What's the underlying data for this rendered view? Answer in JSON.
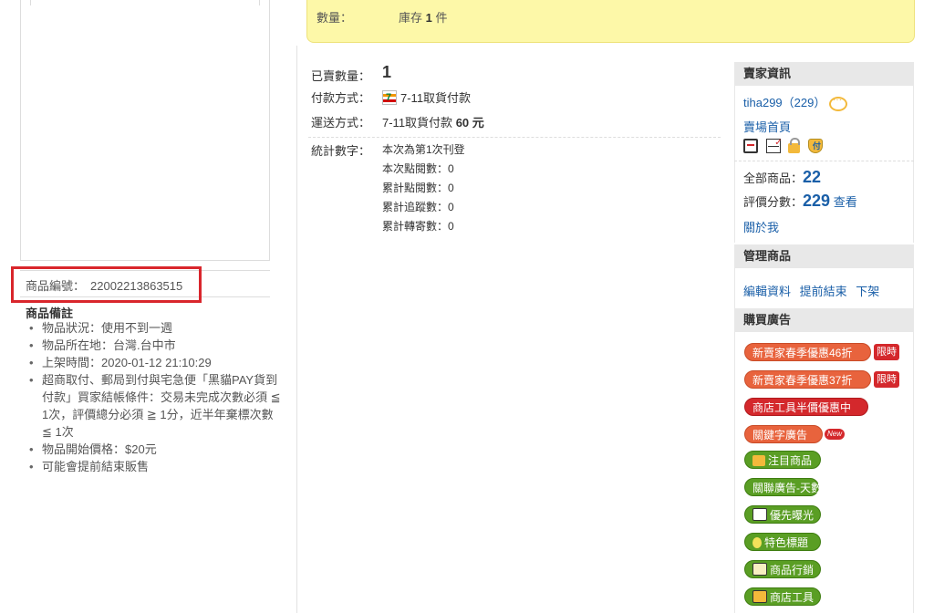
{
  "left": {
    "product_id_label": "商品編號：",
    "product_id_value": "22002213863515",
    "notes_title": "商品備註",
    "notes": [
      "物品狀況：使用不到一週",
      "物品所在地：台灣.台中市",
      "上架時間：2020-01-12 21:10:29",
      "超商取付、郵局到付與宅急便「黑貓PAY貨到付款」買家結帳條件：交易未完成次數必須 ≦ 1次，評價總分必須 ≧ 1分，近半年棄標次數 ≦ 1次",
      "物品開始價格：$20元",
      "可能會提前結束販售"
    ]
  },
  "top": {
    "quantity_label": "數量：",
    "stock_text_prefix": "庫存",
    "stock_num": "1",
    "stock_unit": "件"
  },
  "middle": {
    "sold_label": "已賣數量：",
    "sold_value": "1",
    "payment_label": "付款方式：",
    "payment_value": "7-11取貨付款",
    "shipping_label": "運送方式：",
    "shipping_value": "7-11取貨付款",
    "shipping_fee": "60",
    "shipping_unit": "元",
    "stats_label": "統計數字：",
    "stats": [
      "本次為第1次刊登",
      "本次點閱數：0",
      "累計點閱數：0",
      "累計追蹤數：0",
      "累計轉寄數：0"
    ]
  },
  "seller": {
    "header": "賣家資訊",
    "name": "tiha299",
    "rating_paren": "（229）",
    "store_home": "賣場首頁",
    "total_items_label": "全部商品：",
    "total_items_value": "22",
    "score_label": "評價分數：",
    "score_value": "229",
    "view_link": "查看",
    "about_link": "關於我"
  },
  "manage": {
    "header": "管理商品",
    "links": [
      "編輯資料",
      "提前結束",
      "下架"
    ]
  },
  "ads": {
    "header": "購買廣告",
    "limit_tag": "限時",
    "new_tag": "New",
    "buttons": [
      "新賣家春季優惠46折",
      "新賣家春季優惠37折",
      "商店工具半價優惠中",
      "關鍵字廣告",
      "注目商品",
      "關聯廣告-天數",
      "優先曝光",
      "特色標題",
      "商品行銷",
      "商店工具"
    ]
  },
  "colors": {
    "accent_blue": "#1a5fa8",
    "highlight_red": "#d9262c",
    "yellow_bg": "#fdf8a8",
    "btn_orange": "#e8633d",
    "btn_red": "#d4282c",
    "btn_green": "#5a9e24"
  }
}
